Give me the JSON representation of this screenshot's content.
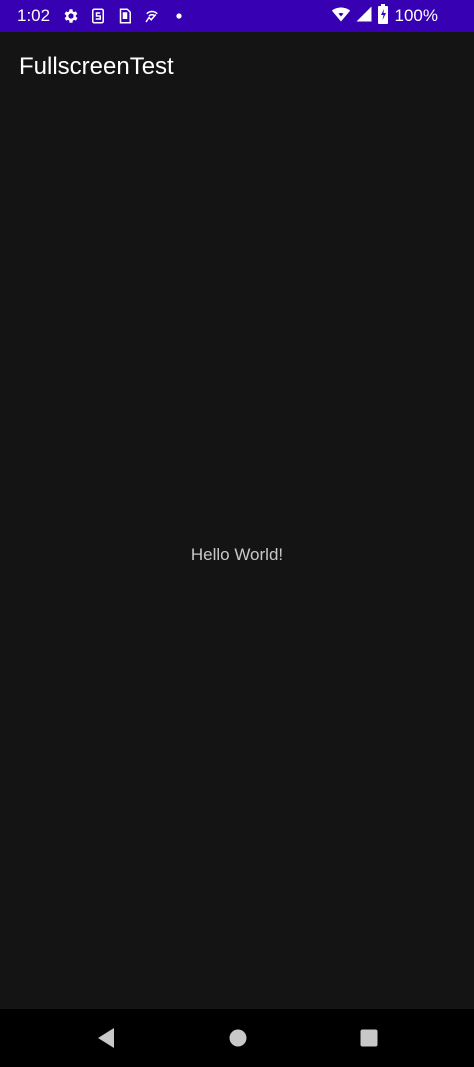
{
  "status_bar": {
    "time": "1:02",
    "battery_percent": "100%",
    "background_color": "#3700b3",
    "icons_left": [
      "gear-icon",
      "sim-s-icon",
      "sd-card-icon",
      "wifi-call-icon",
      "dot-icon"
    ],
    "icons_right": [
      "wifi-icon",
      "signal-icon",
      "battery-icon"
    ]
  },
  "app_bar": {
    "title": "FullscreenTest"
  },
  "main": {
    "message": "Hello World!"
  },
  "nav_bar": {
    "buttons": [
      "back-icon",
      "home-icon",
      "recents-icon"
    ]
  },
  "colors": {
    "background": "#141414",
    "status_bar": "#3700b3",
    "nav_bar": "#000000",
    "text_primary": "#ffffff",
    "text_secondary": "#c8c8c8"
  }
}
